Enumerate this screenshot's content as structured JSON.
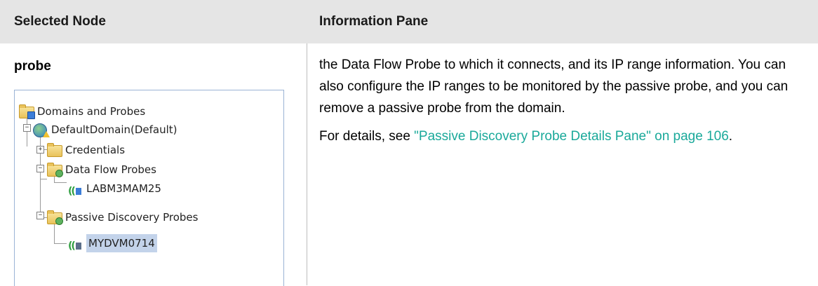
{
  "table": {
    "headers": [
      "Selected Node",
      "Information Pane"
    ],
    "rows": [
      {
        "selected_node": "probe",
        "tree": {
          "items": [
            {
              "label": "Domains and Probes",
              "icon": "domains-probes-icon"
            },
            {
              "label": "DefaultDomain(Default)",
              "icon": "domain-warning-icon",
              "expander": "−"
            },
            {
              "label": "Credentials",
              "icon": "folder-icon",
              "expander": "+"
            },
            {
              "label": "Data Flow Probes",
              "icon": "probe-folder-icon",
              "expander": "−"
            },
            {
              "label": "LABM3MAM25",
              "icon": "probe-icon"
            },
            {
              "label": "Passive Discovery Probes",
              "icon": "passive-folder-icon",
              "expander": "−"
            },
            {
              "label": "MYDVM0714",
              "icon": "passive-probe-icon",
              "selected": true
            }
          ]
        },
        "information": {
          "paragraph1": "the Data Flow Probe to which it connects, and its IP range information. You can also configure the IP ranges to be monitored by the passive probe, and you can remove a passive probe from the domain.",
          "paragraph2_prefix": "For details, see ",
          "paragraph2_link": "\"Passive Discovery Probe Details Pane\" on page 106",
          "paragraph2_suffix": "."
        }
      }
    ]
  },
  "colors": {
    "header_bg": "#e5e5e5",
    "link": "#1aa99a",
    "tree_border": "#9ab3d5",
    "selection_bg": "#c3d3ea"
  }
}
